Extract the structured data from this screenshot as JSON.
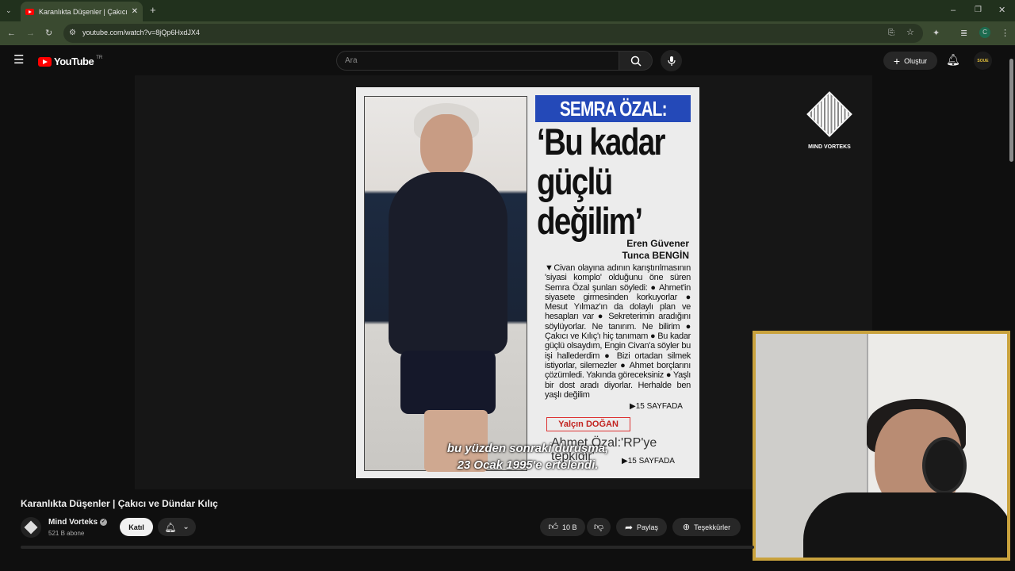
{
  "browser": {
    "tab_title": "Karanlıkta Düşenler | Çakıcı ve D",
    "url": "youtube.com/watch?v=8jQp6HxdJX4",
    "new_tab_label": "+"
  },
  "youtube": {
    "logo_text": "YouTube",
    "region": "TR",
    "search_placeholder": "Ara",
    "create_label": "Oluştur",
    "avatar_text": "SOUE"
  },
  "video": {
    "clip": {
      "headline": "SEMRA ÖZAL:",
      "quote_lines": [
        "‘Bu kadar",
        "güçlü",
        "değilim’"
      ],
      "author_1": "Eren Güvener",
      "author_2": "Tunca BENGİN",
      "body_text": "▼Civan olayına adının karıştırılmasının 'siyasi komplo' olduğunu öne süren Semra Özal şunları söyledi: ● Ahmet'in siyasete girmesinden korkuyorlar ● Mesut Yılmaz'ın da dolaylı plan ve hesapları var ● Sekreterimin aradığını söylüyorlar. Ne tanırım. Ne bilirim ● Çakıcı ve Kılıç'ı hiç tanımam ● Bu kadar güçlü olsaydım, Engin Civan'a söyler bu işi hallederdim ● Bizi ortadan silmek istiyorlar, silemezler ● Ahmet borçlarını çözümledi. Yakında göreceksiniz ● Yaşlı bir dost aradı diyorlar. Herhalde ben yaşlı değilim",
      "page_ref_1": "▶15 SAYFADA",
      "byline_2": "Yalçın DOĞAN",
      "sub_headline": "Ahmet Özal:'RP'ye",
      "sub_headline_2": "tepkidir'",
      "page_ref_2": "▶15 SAYFADA"
    },
    "subtitle_line_1": "bu yüzden sonraki duruşma,",
    "subtitle_line_2": "23 Ocak 1995'e ertelendi.",
    "brand_label": "MIND VORTEKS"
  },
  "details": {
    "title": "Karanlıkta Düşenler | Çakıcı ve Dündar Kılıç",
    "channel_name": "Mind Vorteks",
    "subscribers": "521 B abone",
    "join_label": "Katıl",
    "likes": "10 B",
    "share_label": "Paylaş",
    "thanks_label": "Teşekkürler"
  },
  "colors": {
    "accent_red": "#ff0000",
    "webcam_border": "#c9a23d",
    "headline_blue": "#2449b8"
  }
}
